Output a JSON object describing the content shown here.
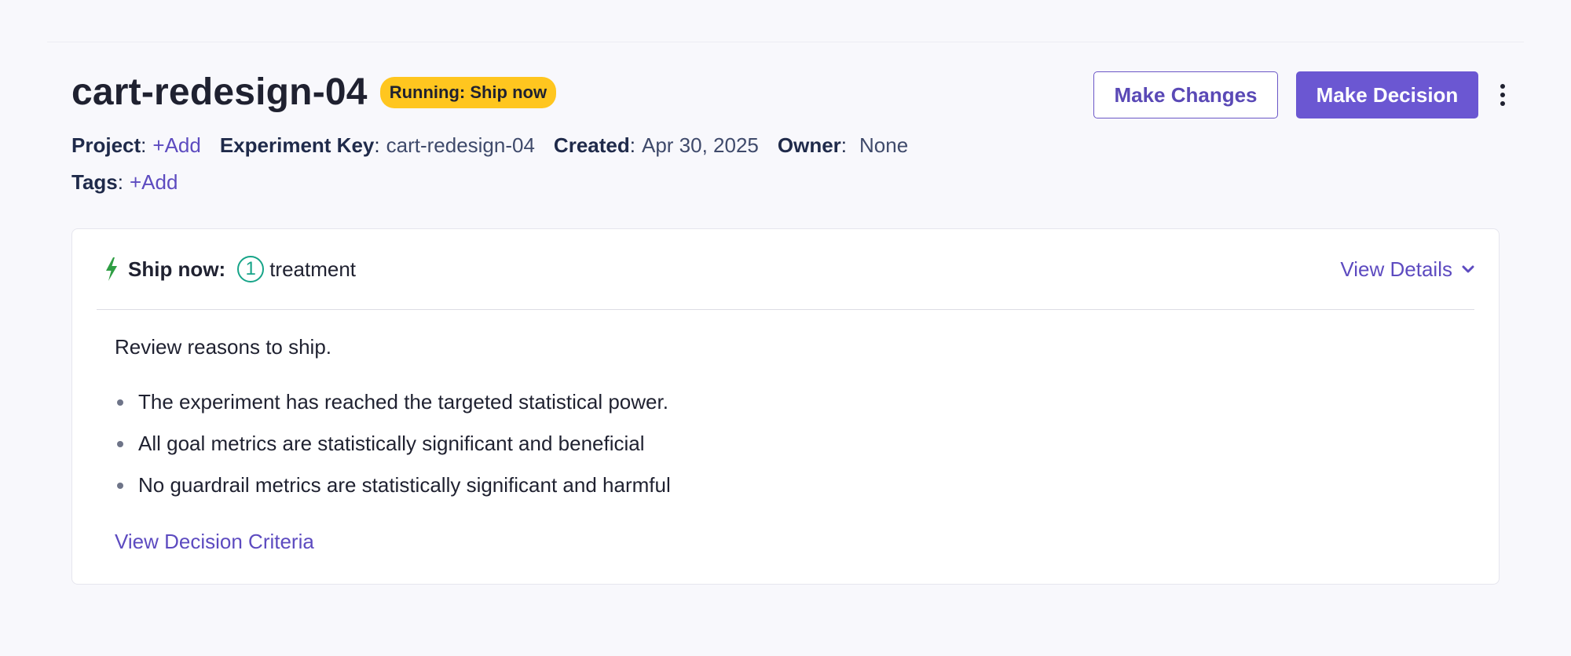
{
  "experiment": {
    "title": "cart-redesign-04",
    "status": "Running: Ship now"
  },
  "actions": {
    "make_changes": "Make Changes",
    "make_decision": "Make Decision",
    "more_icon": "kebab-vertical-icon"
  },
  "meta": {
    "project": {
      "key": "Project",
      "value": "+Add"
    },
    "experiment_key": {
      "key": "Experiment Key",
      "value": "cart-redesign-04"
    },
    "created": {
      "key": "Created",
      "value": "Apr 30, 2025"
    },
    "owner": {
      "key": "Owner",
      "value": "None"
    },
    "tags": {
      "key": "Tags",
      "value": "+Add"
    },
    "separator": ":"
  },
  "decision": {
    "icon": "lightning-bolt-icon",
    "label": "Ship now:",
    "variant_number": "1",
    "variant_name": "treatment",
    "view_details": "View Details",
    "intro": "Review reasons to ship.",
    "reasons": [
      "The experiment has reached the targeted statistical power.",
      "All goal metrics are statistically significant and beneficial",
      "No guardrail metrics are statistically significant and harmful"
    ],
    "criteria_link": "View Decision Criteria"
  },
  "colors": {
    "accent": "#6b57d2",
    "badge": "#ffc61f",
    "success": "#17a488",
    "bolt": "#2f9e44",
    "background": "#f8f8fc"
  }
}
